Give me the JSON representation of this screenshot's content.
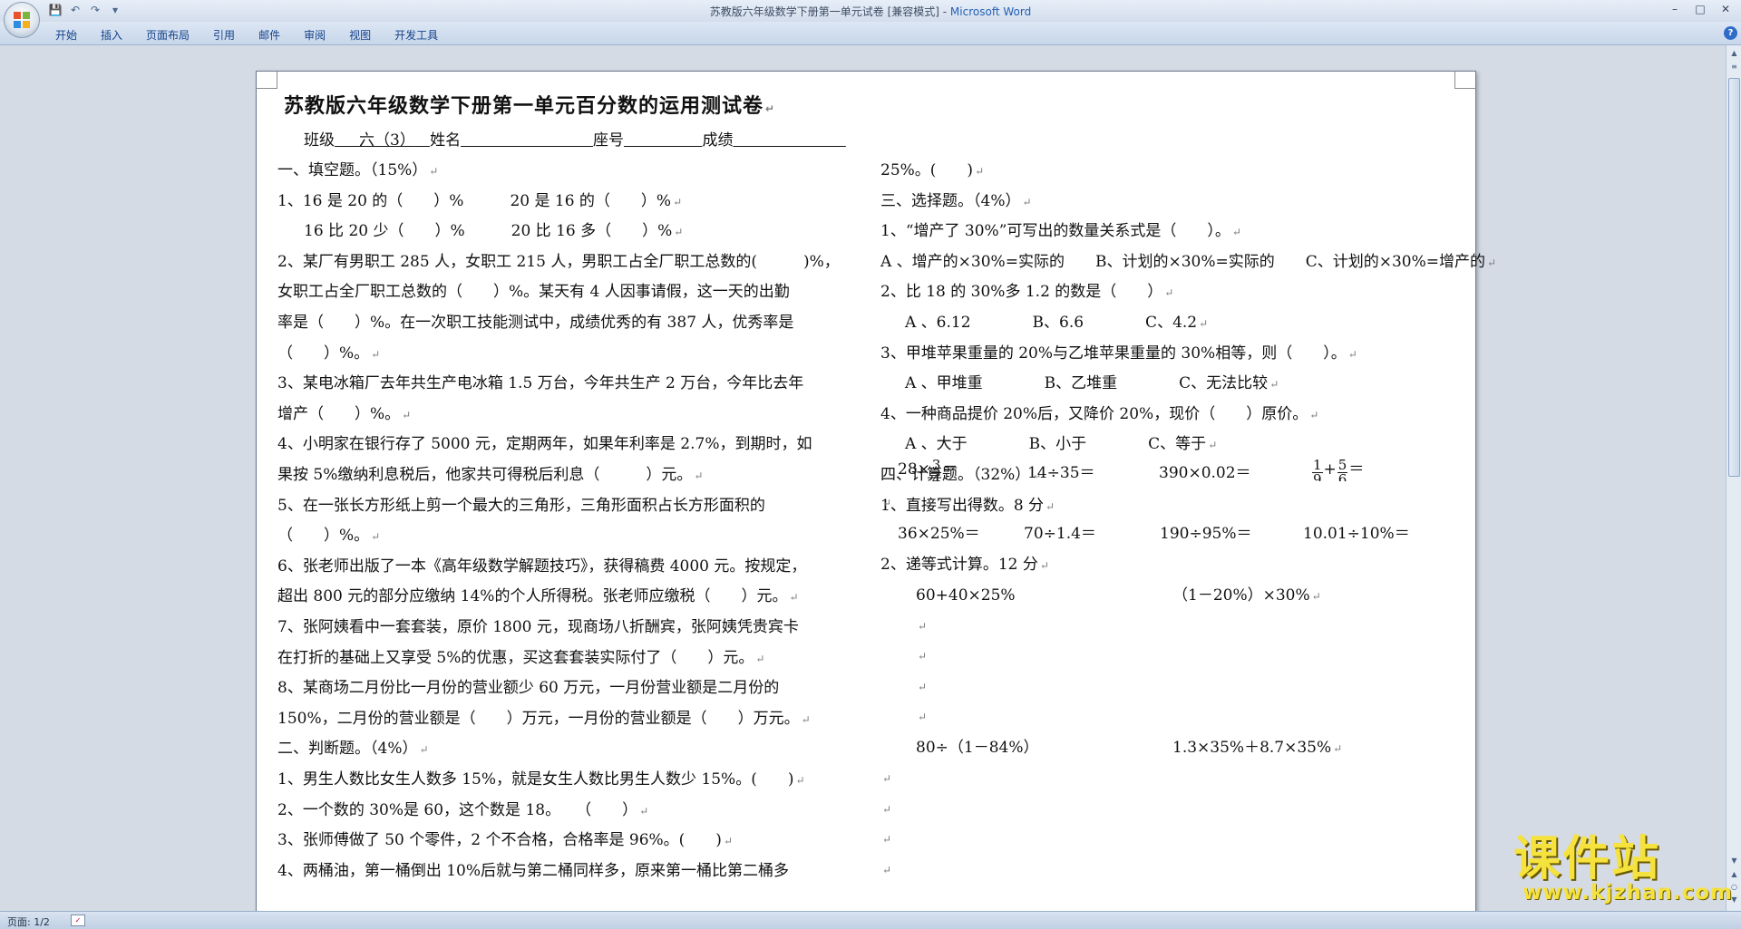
{
  "window": {
    "title": "苏教版六年级数学下册第一单元试卷 [兼容模式] - ",
    "app_name": "Microsoft Word"
  },
  "ribbon": {
    "tabs": [
      "开始",
      "插入",
      "页面布局",
      "引用",
      "邮件",
      "审阅",
      "视图",
      "开发工具"
    ]
  },
  "qat": {
    "icons": [
      "save-icon",
      "undo-icon",
      "redo-icon",
      "customize-icon"
    ]
  },
  "status": {
    "page": "页面: 1/2"
  },
  "document": {
    "title": "苏教版六年级数学下册第一单元百分数的运用测试卷",
    "header_line": {
      "class_label": "班级",
      "class_value": "六（3）",
      "name_label": "姓名",
      "seat_label": "座号",
      "score_label": "成绩"
    },
    "left_lines": [
      "一、填空题。（15%）",
      "1、16 是 20 的（　　）%　　　20 是 16 的（　　）%",
      "16 比 20 少（　　）%　　　20 比 16 多（　　）%",
      "2、某厂有男职工 285 人，女职工 215 人，男职工占全厂职工总数的(　　　)%，",
      "女职工占全厂职工总数的（　　）%。某天有 4 人因事请假，这一天的出勤",
      "率是（　　）%。在一次职工技能测试中，成绩优秀的有 387 人，优秀率是",
      "（　　）%。",
      "3、某电冰箱厂去年共生产电冰箱 1.5 万台，今年共生产 2 万台，今年比去年",
      "增产（　　）%。",
      "4、小明家在银行存了 5000 元，定期两年，如果年利率是 2.7%，到期时，如",
      "果按 5%缴纳利息税后，他家共可得税后利息（　　　）元。",
      "5、在一张长方形纸上剪一个最大的三角形，三角形面积占长方形面积的",
      "（　　）%。",
      "6、张老师出版了一本《高年级数学解题技巧》，获得稿费 4000 元。按规定，",
      "超出 800 元的部分应缴纳 14%的个人所得税。张老师应缴税（　　）元。",
      "7、张阿姨看中一套套装，原价 1800 元，现商场八折酬宾，张阿姨凭贵宾卡",
      "在打折的基础上又享受 5%的优惠，买这套套装实际付了（　　）元。",
      "8、某商场二月份比一月份的营业额少 60 万元，一月份营业额是二月份的",
      "150%，二月份的营业额是（　　）万元，一月份的营业额是（　　）万元。",
      "二、判断题。（4%）",
      "1、男生人数比女生人数多 15%，就是女生人数比男生人数少 15%。(　　)",
      "2、一个数的 30%是 60，这个数是 18。　　（　　）",
      "3、张师傅做了 50 个零件，2 个不合格，合格率是 96%。(　　)",
      "4、两桶油，第一桶倒出 10%后就与第二桶同样多，原来第一桶比第二桶多"
    ],
    "right_lines": [
      "25%。(　　)",
      "三、选择题。（4%）",
      "1、“增产了 30%”可写出的数量关系式是（　　）。",
      "A 、增产的×30%=实际的　　B、计划的×30%=实际的　　C、计划的×30%=增产的",
      "2、比 18 的 30%多 1.2 的数是（　　）",
      "A 、6.12　　　　B、6.6　　　　C、4.2",
      "3、甲堆苹果重量的 20%与乙堆苹果重量的 30%相等，则（　　）。",
      "A 、甲堆重　　　　B、乙堆重　　　　C、无法比较",
      "4、一种商品提价 20%后，又降价 20%，现价（　　）原价。",
      "A 、大于　　　　B、小于　　　　C、等于",
      "四、计算题。（32%）",
      "1、直接写出得数。8 分"
    ],
    "calc_row1": {
      "item1_prefix": "28×",
      "item1_num": "3",
      "item1_den": "4",
      "item1_suffix": "＝",
      "item2": "14÷35＝",
      "item3": "390×0.02＝",
      "item4_num1": "1",
      "item4_den1": "9",
      "item4_plus": "+",
      "item4_num2": "5",
      "item4_den2": "6",
      "item4_suffix": "＝"
    },
    "calc_row2": [
      "36×25%＝",
      "70÷1.4＝",
      "190÷95%＝",
      "10.01÷10%＝"
    ],
    "section2_title": "2、递等式计算。12 分",
    "step_calc": [
      "60+40×25%",
      "（1－20%）×30%",
      "80÷（1－84%）",
      "1.3×35%＋8.7×35%"
    ],
    "para_mark": "↵"
  },
  "watermark": {
    "text": "课件站",
    "url": "www.kjzhan.com"
  }
}
